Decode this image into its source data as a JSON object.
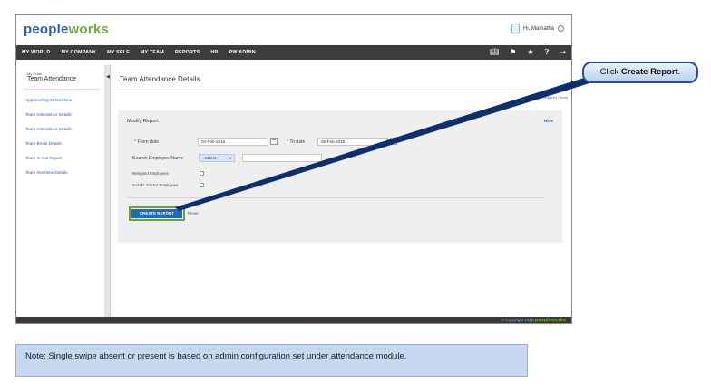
{
  "app": {
    "logo_main": "people",
    "logo_accent": "works",
    "user_greeting": "Hi, Mamatha"
  },
  "nav": {
    "items": [
      "MY WORLD",
      "MY COMPANY",
      "MY SELF",
      "MY TEAM",
      "REPORTS",
      "HR",
      "PW ADMIN"
    ],
    "icons": [
      "book-icon",
      "flag-icon",
      "star-icon",
      "help-icon",
      "logout-icon"
    ]
  },
  "sidebar": {
    "breadcrumb": "My Team",
    "title": "Team Attendance",
    "items": [
      "Approve/Reject Overtime",
      "Team Attendance Details",
      "Team Attendance Details",
      "Team Break Details",
      "Team In-Out Report",
      "Team Overtime Details"
    ]
  },
  "main": {
    "page_title": "Team Attendance Details",
    "required_note": "Required Fields",
    "panel_title": "Modify Report",
    "hide_label": "Hide",
    "from_date_label": "From date",
    "from_date_value": "02-Feb-2015",
    "to_date_label": "To date",
    "to_date_value": "05-Feb-2015",
    "search_label": "Search Employee Name",
    "select_value": "--Select--",
    "select_clear": "x",
    "resigned_label": "Resigned Employees",
    "indirect_label": "Include Indirect Employees",
    "create_button": "CREATE REPORT",
    "reset_label": "Reset"
  },
  "footer": {
    "copyright": "© Copyright 2015",
    "brand": "peopleworks"
  },
  "callout": {
    "prefix": "Click",
    "bold": "Create Report",
    "suffix": "."
  },
  "note": {
    "text": "Note:   Single swipe absent or present is based on admin configuration set under attendance module."
  },
  "colors": {
    "nav_bg": "#3d3d3d",
    "button_bg": "#1f6cb5",
    "highlight": "#6aa13a",
    "arrow": "#0d2f6e",
    "note_bg": "#c6d9f1"
  }
}
